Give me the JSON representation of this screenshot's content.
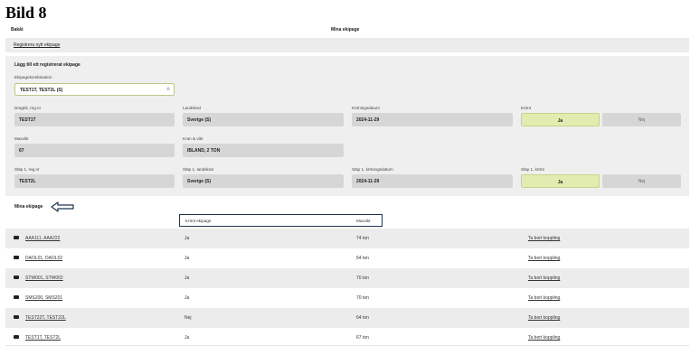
{
  "doc_title": "Bild 8",
  "topbar": {
    "back": "Bakåt",
    "title": "Mina ekipage"
  },
  "register_link": "Registrera nytt ekipage",
  "form": {
    "title": "Lägg till ett registrerat ekipage",
    "combo_label": "Ekipagekombination",
    "combo_value": "TEST1T, TEST2L (S)",
    "combo_clear": "⊗",
    "dragbil_label": "Dragbil, reg.nr",
    "dragbil_value": "TEST1T",
    "landskod_label": "Landskod",
    "landskod_value": "Sverige (S)",
    "kron_label": "Kröningsdatum",
    "kron_value": "2024-11-29",
    "kront_label": "Krönt",
    "kront_yes": "Ja",
    "kront_no": "Nej",
    "maxvikt_label": "Maxvikt",
    "maxvikt_value": "67",
    "kran_label": "Kran & vikt",
    "kran_value": "IBLAND, 2 TON",
    "slap_label": "Släp 1, reg.nr",
    "slap_value": "TEST2L",
    "slap_land_label": "Släp 1, landskod",
    "slap_land_value": "Sverige (S)",
    "slap_kron_label": "Släp 1, kröningsdatum",
    "slap_kron_value": "2024-11-29",
    "slap_kront_label": "Släp 1, krönt",
    "slap_kront_yes": "Ja",
    "slap_kront_no": "Nej"
  },
  "list": {
    "title": "Mina ekipage",
    "col_kront": "Krönt ekipage",
    "col_maxvikt": "Maxvikt",
    "rows": [
      {
        "name": "AAA111, AAA222",
        "kront": "Ja",
        "vikt": "74 ton",
        "action": "Ta bort koppling"
      },
      {
        "name": "DAOL01, DAOL02",
        "kront": "Ja",
        "vikt": "64 ton",
        "action": "Ta bort koppling"
      },
      {
        "name": "STW001, STW002",
        "kront": "Ja",
        "vikt": "70 ton",
        "action": "Ta bort koppling"
      },
      {
        "name": "SMS200, SMS201",
        "kront": "Ja",
        "vikt": "70 ton",
        "action": "Ta bort koppling"
      },
      {
        "name": "TEST22T, TEST22L",
        "kront": "Nej",
        "vikt": "64 ton",
        "action": "Ta bort koppling"
      },
      {
        "name": "TEST1T, TEST2L",
        "kront": "Ja",
        "vikt": "67 ton",
        "action": "Ta bort koppling"
      }
    ]
  },
  "colors": {
    "toggle_on": "#e2ecb0",
    "field_bg": "#d6d6d6",
    "panel_bg": "#efefef",
    "highlight_border": "#1e3550"
  }
}
